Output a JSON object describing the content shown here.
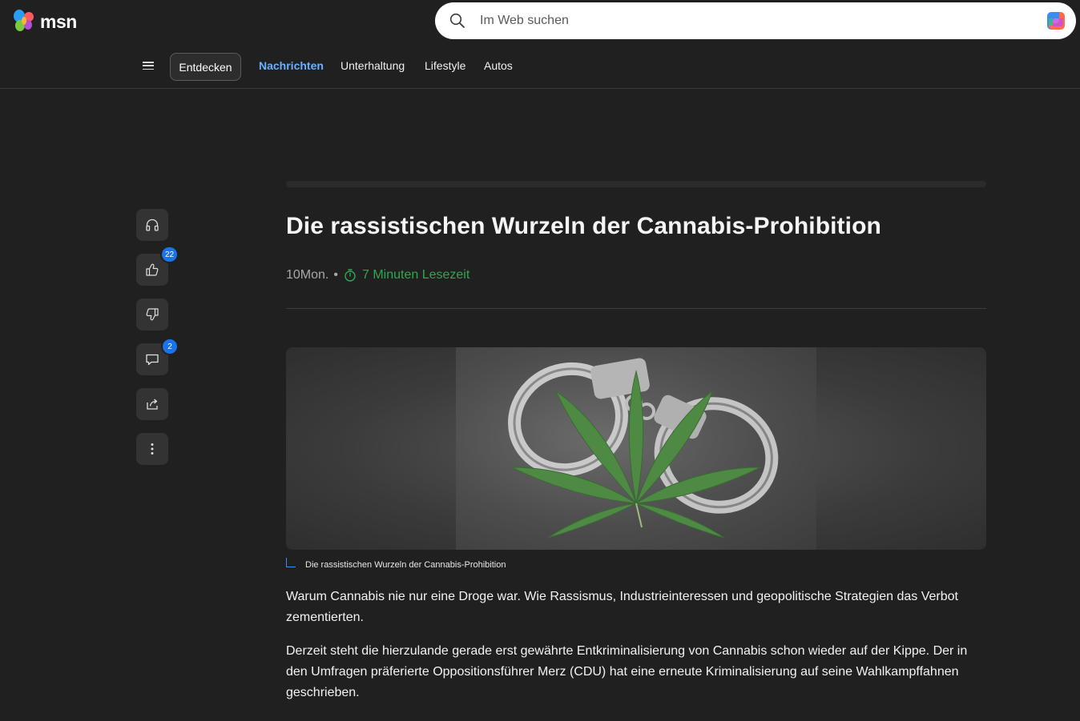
{
  "header": {
    "logo_text": "msn",
    "search_placeholder": "Im Web suchen",
    "icons": [
      "msn-butterfly-icon",
      "search-icon",
      "copilot-icon"
    ]
  },
  "nav": {
    "discover_label": "Entdecken",
    "links": [
      "Nachrichten",
      "Unterhaltung",
      "Lifestyle",
      "Autos"
    ],
    "active": "Nachrichten",
    "active_color": "#6ab0ff"
  },
  "rail": {
    "like_count": "22",
    "comment_count": "2",
    "icons": [
      "headphones-icon",
      "thumbs-up-icon",
      "thumbs-down-icon",
      "comment-icon",
      "share-icon",
      "more-icon"
    ]
  },
  "article": {
    "title": "Die rassistischen Wurzeln der Cannabis-Prohibition",
    "age": "10Mon.",
    "separator": "•",
    "read_time": "7 Minuten Lesezeit",
    "read_time_color": "#2fa84f",
    "image_caption": "Die rassistischen Wurzeln der Cannabis-Prohibition",
    "paragraphs": [
      "Warum Cannabis nie nur eine Droge war. Wie Rassismus, Industrieinteressen und geopolitische Strategien das Verbot zementierten.",
      "Derzeit steht die hierzulande gerade erst gewährte Entkriminalisierung von Cannabis schon wieder auf der Kippe. Der in den Umfragen präferierte Oppositionsführer Merz (CDU) hat eine erneute Kriminalisierung auf seine Wahlkampffahnen geschrieben."
    ]
  },
  "colors": {
    "background": "#202020",
    "badge": "#1a73e8"
  }
}
